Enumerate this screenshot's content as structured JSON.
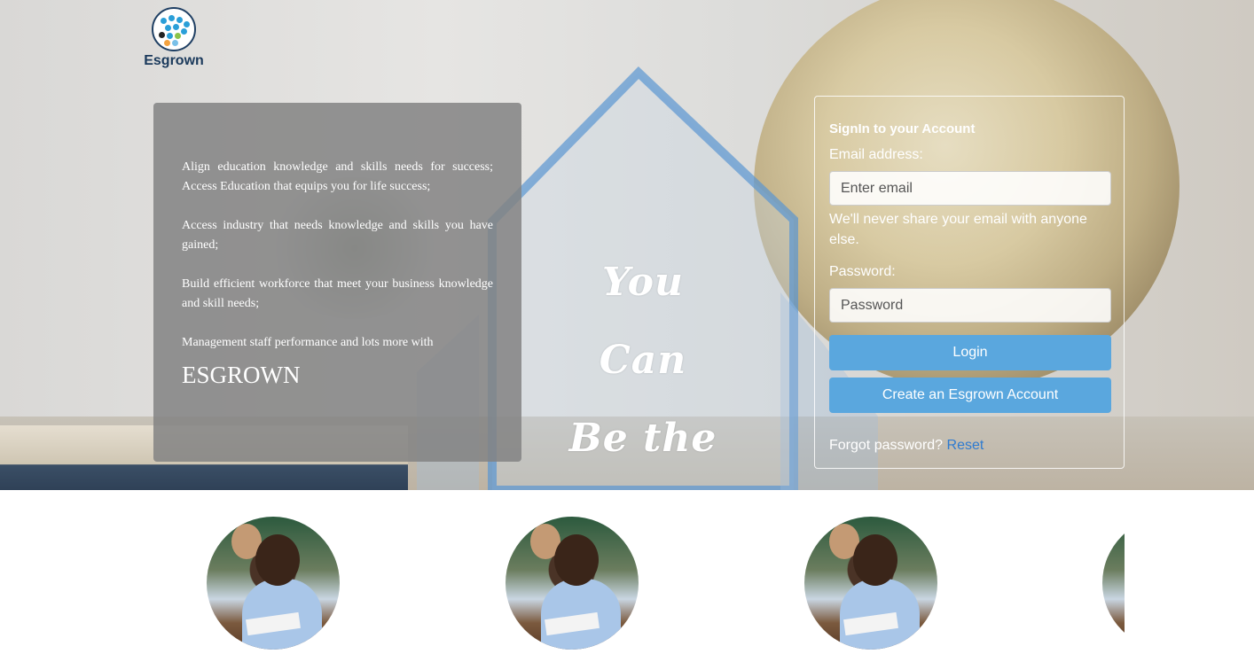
{
  "brand": {
    "logo_text": "Esgrown"
  },
  "info": {
    "lines": [
      "Align education knowledge and skills needs for success; Access Education that equips you for life success;",
      "Access industry that needs knowledge and skills you have gained;",
      "Build efficient workforce that meet your business knowledge and skill needs;",
      "Management staff performance and lots more with"
    ],
    "brand_name": "ESGROWN"
  },
  "slogan": {
    "line1": "You",
    "line2": "Can",
    "line3": "Be the best"
  },
  "login": {
    "title": "SignIn to your Account",
    "email_label": "Email address:",
    "email_placeholder": "Enter email",
    "email_help": "We'll never share your email with anyone else.",
    "password_label": "Password:",
    "password_placeholder": "Password",
    "login_button": "Login",
    "create_button": "Create an Esgrown Account",
    "forgot_text": "Forgot password?",
    "reset_link": "Reset"
  },
  "colors": {
    "button": "#5aa7de",
    "link": "#2f7bd0",
    "panel": "#828282"
  }
}
